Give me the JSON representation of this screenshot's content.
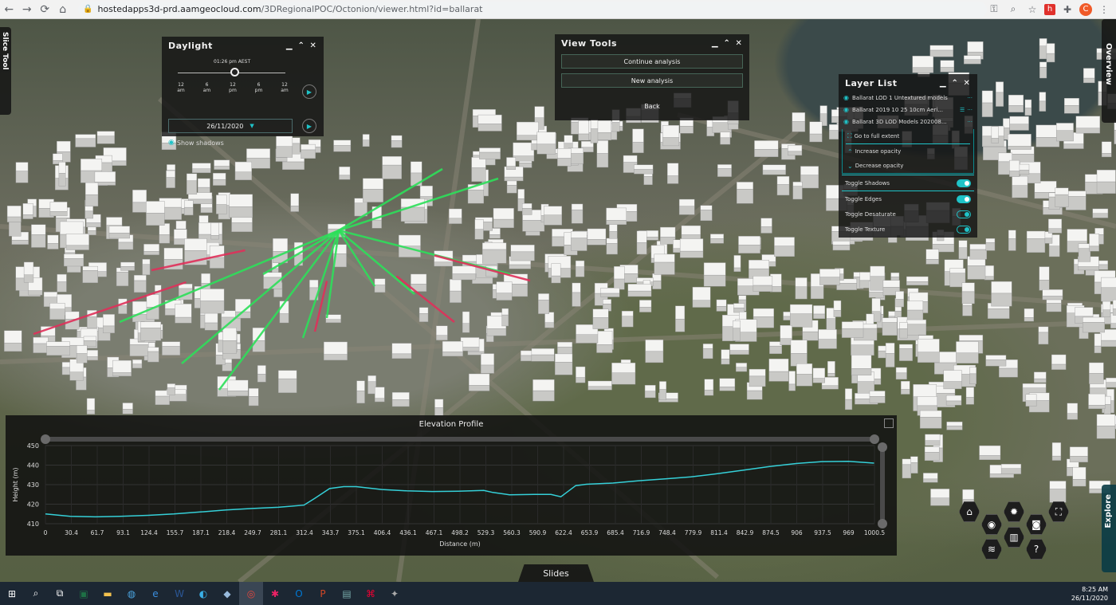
{
  "browser": {
    "url_host": "hostedapps3d-prd.aamgeocloud.com",
    "url_path": "/3DRegionalPOC/Octonion/viewer.html?id=ballarat",
    "profile_initial": "C"
  },
  "side_tabs": {
    "slice_tool": "Slice Tool",
    "overview": "Overview",
    "explore": "Explore"
  },
  "daylight": {
    "title": "Daylight",
    "time": "01:26 pm AEST",
    "ticks": [
      [
        "12",
        "am"
      ],
      [
        "6",
        "am"
      ],
      [
        "12",
        "pm"
      ],
      [
        "6",
        "pm"
      ],
      [
        "12",
        "am"
      ]
    ],
    "date": "26/11/2020",
    "show_shadows": "Show shadows"
  },
  "view_tools": {
    "title": "View Tools",
    "buttons": [
      "Continue analysis",
      "New analysis",
      "Back"
    ]
  },
  "layer_list": {
    "title": "Layer List",
    "layers": [
      "Ballarat LOD 1 Untextured models",
      "Ballarat 2019 10 25 10cm Aeri...",
      "Ballarat 3D LOD Models 202008..."
    ],
    "actions": [
      "Go to full extent",
      "Increase opacity",
      "Decrease opacity"
    ],
    "toggles": [
      {
        "label": "Toggle Shadows",
        "on": true
      },
      {
        "label": "Toggle Edges",
        "on": true
      },
      {
        "label": "Toggle Desaturate",
        "on": false
      },
      {
        "label": "Toggle Texture",
        "on": false
      }
    ]
  },
  "elevation_profile": {
    "title": "Elevation Profile",
    "ylabel": "Height (m)",
    "xlabel": "Distance (m)",
    "y_ticks": [
      "450",
      "440",
      "430",
      "420",
      "410"
    ],
    "x_ticks": [
      "0",
      "30.4",
      "61.7",
      "93.1",
      "124.4",
      "155.7",
      "187.1",
      "218.4",
      "249.7",
      "281.1",
      "312.4",
      "343.7",
      "375.1",
      "406.4",
      "436.1",
      "467.1",
      "498.2",
      "529.3",
      "560.3",
      "590.9",
      "622.4",
      "653.9",
      "685.4",
      "716.9",
      "748.4",
      "779.9",
      "811.4",
      "842.9",
      "874.5",
      "906",
      "937.5",
      "969",
      "1000.5"
    ],
    "color": "#35d0d8",
    "series": [
      [
        0,
        415
      ],
      [
        30,
        413.8
      ],
      [
        60,
        413.5
      ],
      [
        90,
        413.8
      ],
      [
        124,
        414.3
      ],
      [
        155,
        415
      ],
      [
        187,
        416
      ],
      [
        218,
        417
      ],
      [
        250,
        417.8
      ],
      [
        281,
        418.4
      ],
      [
        312,
        419.5
      ],
      [
        325,
        423
      ],
      [
        343,
        428
      ],
      [
        360,
        429
      ],
      [
        375,
        429
      ],
      [
        406,
        427.5
      ],
      [
        436,
        426.8
      ],
      [
        467,
        426.5
      ],
      [
        498,
        426.6
      ],
      [
        529,
        427
      ],
      [
        540,
        426
      ],
      [
        560,
        424.8
      ],
      [
        590,
        425
      ],
      [
        610,
        425
      ],
      [
        622,
        423.8
      ],
      [
        640,
        429.5
      ],
      [
        653,
        430.2
      ],
      [
        685,
        430.8
      ],
      [
        716,
        432
      ],
      [
        748,
        433
      ],
      [
        779,
        434
      ],
      [
        811,
        435.6
      ],
      [
        842,
        437.4
      ],
      [
        874,
        439.3
      ],
      [
        906,
        440.8
      ],
      [
        937,
        441.8
      ],
      [
        969,
        441.9
      ],
      [
        1000,
        441
      ]
    ]
  },
  "nav_icons": [
    "home-icon",
    "eye-icon",
    "gear-icon",
    "fullscreen-icon",
    "layers-icon",
    "map-icon",
    "camera-icon",
    "help-icon"
  ],
  "slides": "Slides",
  "taskbar": {
    "time": "8:25 AM",
    "date": "26/11/2020"
  }
}
